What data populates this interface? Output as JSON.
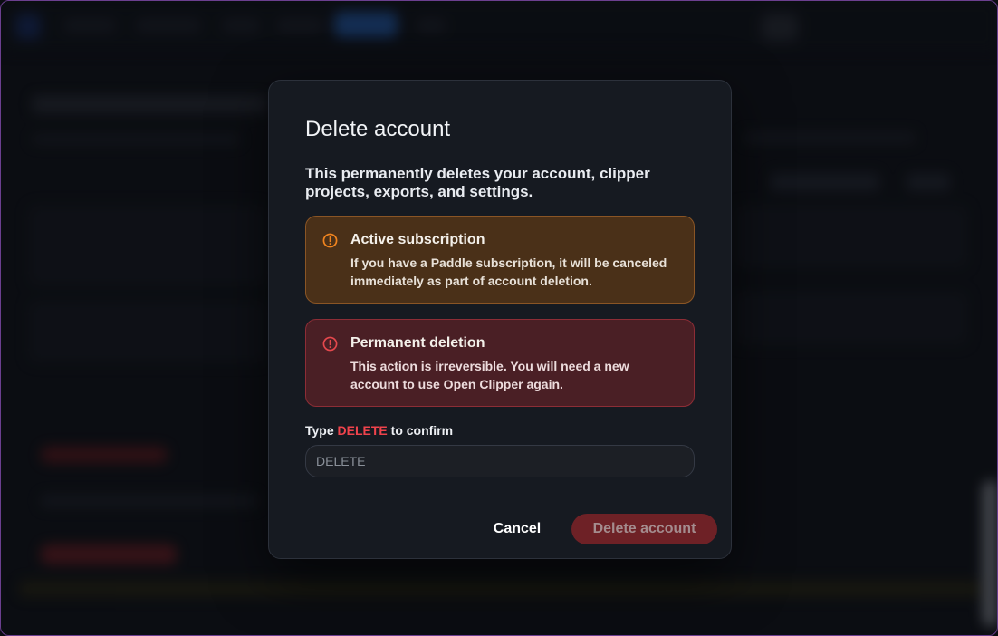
{
  "modal": {
    "title": "Delete account",
    "description": "This permanently deletes your account, clipper projects, exports, and settings.",
    "alerts": [
      {
        "icon": "warning-circle-icon",
        "color": "#f0841f",
        "title": "Active subscription",
        "text": "If you have a Paddle subscription, it will be canceled immediately as part of account deletion."
      },
      {
        "icon": "error-circle-icon",
        "color": "#e5484d",
        "title": "Permanent deletion",
        "text": "This action is irreversible. You will need a new account to use Open Clipper again."
      }
    ],
    "confirm": {
      "prefix": "Type",
      "keyword": "DELETE",
      "suffix": "to confirm",
      "placeholder": "DELETE",
      "value": ""
    },
    "buttons": {
      "cancel": "Cancel",
      "delete": "Delete account",
      "delete_disabled": true
    }
  },
  "colors": {
    "accent_danger": "#f0434c",
    "warning": "#f0841f"
  }
}
